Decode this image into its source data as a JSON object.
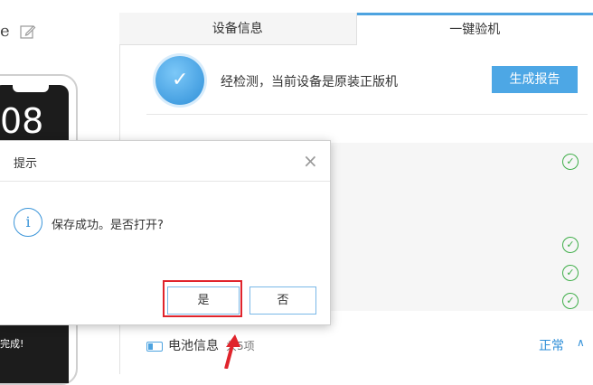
{
  "device": {
    "name_fragment": "e",
    "clock_fragment": "08",
    "done_text": "完成!"
  },
  "tabs": [
    {
      "label": "设备信息",
      "active": false
    },
    {
      "label": "一键验机",
      "active": true
    }
  ],
  "verify": {
    "status_text": "经检测，当前设备是原装正版机",
    "report_button": "生成报告"
  },
  "battery": {
    "label": "电池信息",
    "count": "共5项",
    "status": "正常"
  },
  "dialog": {
    "title": "提示",
    "close": "×",
    "message": "保存成功。是否打开?",
    "yes_label": "是",
    "no_label": "否",
    "info_glyph": "i"
  },
  "icons": {
    "check": "✓",
    "chevron_up": "∧"
  },
  "colors": {
    "accent_blue": "#4da7e5",
    "success_green": "#3fae49",
    "highlight_red": "#e0242c"
  }
}
